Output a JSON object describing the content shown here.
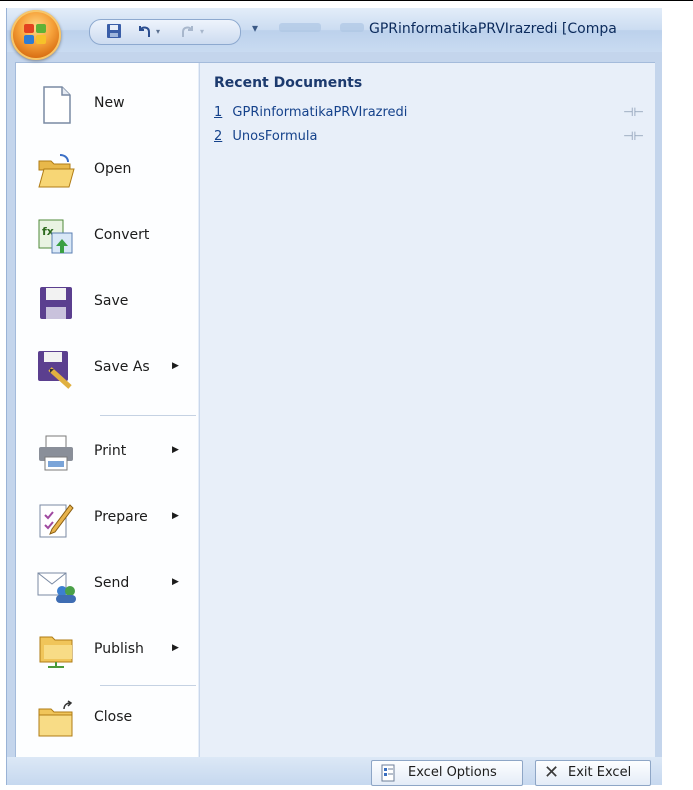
{
  "window": {
    "title": "GPRinformatikaPRVIrazredi  [Compa",
    "qat": {
      "save_icon": "floppy-icon",
      "undo_icon": "undo-icon",
      "redo_icon": "redo-icon",
      "more": "▾"
    }
  },
  "menu": {
    "items": [
      {
        "label": "New",
        "accel": "N",
        "has_submenu": false,
        "icon": "new-document-icon"
      },
      {
        "label": "Open",
        "accel": "O",
        "has_submenu": false,
        "icon": "open-folder-icon"
      },
      {
        "label": "Convert",
        "accel": "v",
        "has_submenu": false,
        "icon": "convert-icon"
      },
      {
        "label": "Save",
        "accel": "S",
        "has_submenu": false,
        "icon": "floppy-icon"
      },
      {
        "label": "Save As",
        "accel": "A",
        "has_submenu": true,
        "icon": "save-as-icon"
      },
      {
        "label": "Print",
        "accel": "P",
        "has_submenu": true,
        "icon": "printer-icon"
      },
      {
        "label": "Prepare",
        "accel": "e",
        "has_submenu": true,
        "icon": "prepare-icon"
      },
      {
        "label": "Send",
        "accel": "d",
        "has_submenu": true,
        "icon": "send-icon"
      },
      {
        "label": "Publish",
        "accel": "u",
        "has_submenu": true,
        "icon": "publish-icon"
      },
      {
        "label": "Close",
        "accel": "C",
        "has_submenu": false,
        "icon": "close-folder-icon"
      }
    ]
  },
  "recent": {
    "heading": "Recent Documents",
    "documents": [
      {
        "number": "1",
        "name": "GPRinformatikaPRVIrazredi"
      },
      {
        "number": "2",
        "name": "UnosFormula"
      }
    ]
  },
  "footer": {
    "options_label": "Excel Options",
    "exit_label": "Exit Excel"
  }
}
